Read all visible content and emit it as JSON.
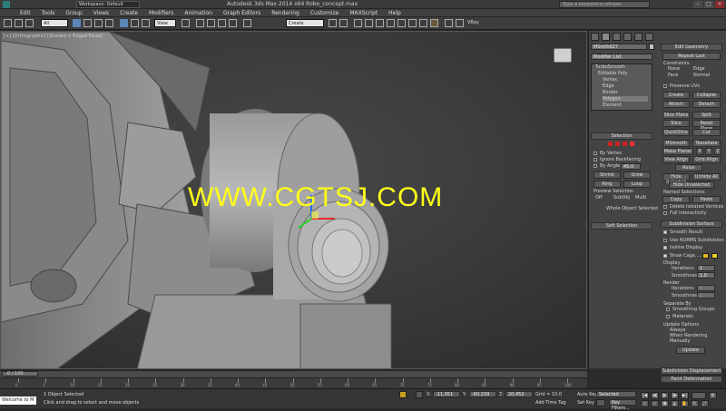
{
  "window": {
    "workspace": "Workspace: Default",
    "title": "Autodesk 3ds Max 2014 x64    Robo_concept.max",
    "search_placeholder": "Type a keyword or phrase"
  },
  "menu": [
    "Edit",
    "Tools",
    "Group",
    "Views",
    "Create",
    "Modifiers",
    "Animation",
    "Graph Editors",
    "Rendering",
    "Customize",
    "MAXScript",
    "Help"
  ],
  "toolbar": {
    "filter_dropdown": "All",
    "view_dropdown": "View",
    "selection_set": "Create Selection Se",
    "vray_label": "VRay"
  },
  "viewport": {
    "label": "[+] [Orthographic] [Shaded + Edged Faces]",
    "watermark": "WWW.CGTSJ.COM"
  },
  "command_panel": {
    "object_name": "MSmth027",
    "modifier_list": "Modifier List",
    "stack": [
      "TurboSmooth",
      "Editable Poly",
      "Vertex",
      "Edge",
      "Border",
      "Polygon",
      "Element"
    ],
    "selection_rollout": "Selection",
    "by_vertex": "By Vertex",
    "ignore_backfacing": "Ignore Backfacing",
    "by_angle": "By Angle:",
    "by_angle_value": "45.0",
    "shrink": "Shrink",
    "grow": "Grow",
    "ring": "Ring",
    "loop": "Loop",
    "preview_selection": "Preview Selection",
    "preview_off": "Off",
    "preview_subobj": "SubObj",
    "preview_multi": "Multi",
    "whole_object": "Whole Object Selected",
    "soft_selection": "Soft Selection",
    "edit_geometry": "Edit Geometry",
    "repeat_last": "Repeat Last",
    "constraints": "Constraints",
    "c_none": "None",
    "c_edge": "Edge",
    "c_face": "Face",
    "c_normal": "Normal",
    "preserve_uvs": "Preserve UVs",
    "create": "Create",
    "collapse": "Collapse",
    "attach": "Attach",
    "detach": "Detach",
    "slice_plane": "Slice Plane",
    "split": "Split",
    "slice": "Slice",
    "reset_plane": "Reset Plane",
    "quickslice": "QuickSlice",
    "cut": "Cut",
    "msmooth": "MSmooth",
    "tessellate": "Tessellate",
    "make_planar": "Make Planar",
    "x": "X",
    "y": "Y",
    "z": "Z",
    "view_align": "View Align",
    "grid_align": "Grid Align",
    "relax": "Relax",
    "hide_selected": "Hide Selected",
    "unhide_all": "Unhide All",
    "hide_unselected": "Hide Unselected",
    "named_selections": "Named Selections:",
    "copy": "Copy",
    "paste": "Paste",
    "delete_isolated": "Delete Isolated Vertices",
    "full_interactivity": "Full Interactivity",
    "subdivision_surface": "Subdivision Surface",
    "smooth_result": "Smooth Result",
    "use_nurms": "Use NURMS Subdivision",
    "isoline_display": "Isoline Display",
    "show_cage": "Show Cage......",
    "display": "Display",
    "iterations": "Iterations:",
    "iterations_val": "1",
    "smoothness": "Smoothness:",
    "smoothness_val": "1.0",
    "render": "Render",
    "r_iterations": "Iterations:",
    "r_iterations_val": "0",
    "r_smoothness": "Smoothness:",
    "r_smoothness_val": "1",
    "separate_by": "Separate By",
    "smoothing_groups": "Smoothing Groups",
    "materials": "Materials",
    "update_options": "Update Options",
    "always": "Always",
    "when_rendering": "When Rendering",
    "manually": "Manually",
    "update": "Update",
    "subdivision_displacement": "Subdivision Displacement",
    "paint_deformation": "Paint Deformation"
  },
  "timeline": {
    "frame": "0 / 100",
    "ticks": [
      "0",
      "5",
      "10",
      "15",
      "20",
      "25",
      "30",
      "35",
      "40",
      "45",
      "50",
      "55",
      "60",
      "65",
      "70",
      "75",
      "80",
      "85",
      "90",
      "95",
      "100"
    ]
  },
  "status": {
    "maxscript": "Welcome to M",
    "selected": "1 Object Selected",
    "prompt": "Click and drag to select and move objects",
    "x_label": "X:",
    "x_val": "-11,051",
    "y_label": "Y:",
    "y_val": "-60,239",
    "z_label": "Z:",
    "z_val": "20,452",
    "grid": "Grid = 10,0",
    "add_time_tag": "Add Time Tag",
    "auto_key": "Auto Key",
    "set_key": "Set Key",
    "key_mode": "Selected",
    "key_filters": "Key Filters..."
  }
}
